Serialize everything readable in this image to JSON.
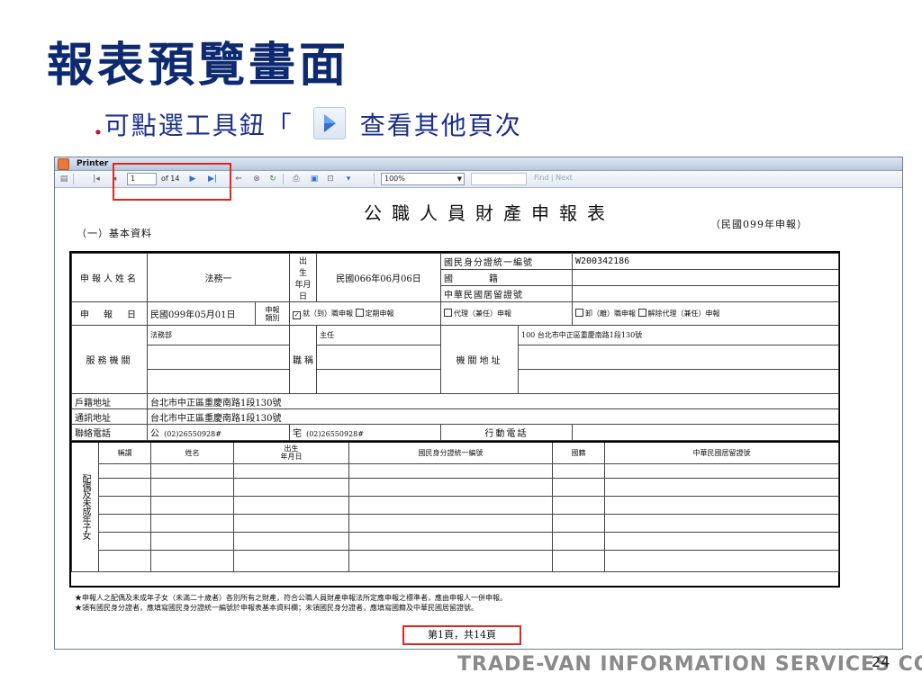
{
  "slide": {
    "title": "報表預覽畫面",
    "bullet_dot": ".",
    "bullet_before": "可點選工具鈕「",
    "bullet_after": "查看其他頁次",
    "play_icon": "play-triangle-icon",
    "page_number": "24",
    "company": "TRADE-VAN INFORMATION SERVICES CO."
  },
  "window": {
    "title": "Printer",
    "toolbar": {
      "current_page": "1",
      "of_label": "of 14",
      "zoom": "100%",
      "find_next": "Find | Next"
    }
  },
  "report": {
    "title": "公職人員財產申報表",
    "basic_info_label": "（一）基本資料",
    "year_label": "（民國099年申報）",
    "labels": {
      "applicant_name": "申報人姓名",
      "birth": "出　生\n年月日",
      "id_no": "國民身分證統一編號",
      "nationality": "國　　　　籍",
      "resident_id": "中華民國居留證號",
      "apply_date": "申　報　日",
      "apply_type": "申報\n類別",
      "service_org": "服務機關",
      "position": "職稱",
      "org_address": "機關地址",
      "household_address": "戶籍地址",
      "mail_address": "通訊地址",
      "phone": "聯絡電話",
      "mobile": "行動電話",
      "office_prefix": "公",
      "home_prefix": "宅",
      "family_vertical": "配偶及未成年子女"
    },
    "values": {
      "applicant_name": "法務一",
      "birth_date": "民國066年06月06日",
      "id_no": "W200342186",
      "apply_date": "民國099年05月01日",
      "org_name": "法務部",
      "position": "主任",
      "org_address": "100 台北市中正區重慶南路1段130號",
      "household_address": "台北市中正區重慶南路1段130號",
      "mail_address": "台北市中正區重慶南路1段130號",
      "office_phone": "(02)26550928#",
      "home_phone": "(02)26550928#"
    },
    "apply_types": {
      "on_duty": "就（到）職申報",
      "periodic": "定期申報",
      "acting": "代理（兼任）申報",
      "leave": "卸（離）職申報",
      "release_acting": "解除代理（兼任）申報"
    },
    "family_headers": [
      "稱謂",
      "姓名",
      "出生\n年月日",
      "國民身分證統一編號",
      "國籍",
      "中華民國居留證號"
    ],
    "notes": [
      "★申報人之配偶及未成年子女（未滿二十歲者）各別所有之財產，符合公職人員財產申報法所定應申報之標準者，應由申報人一併申報。",
      "★領有國民身分證者，應填寫國民身分證統一編號於申報表基本資料欄；未領國民身分證者，應填寫國籍及中華民國居留證號。"
    ],
    "footer": "第1頁，共14頁"
  }
}
